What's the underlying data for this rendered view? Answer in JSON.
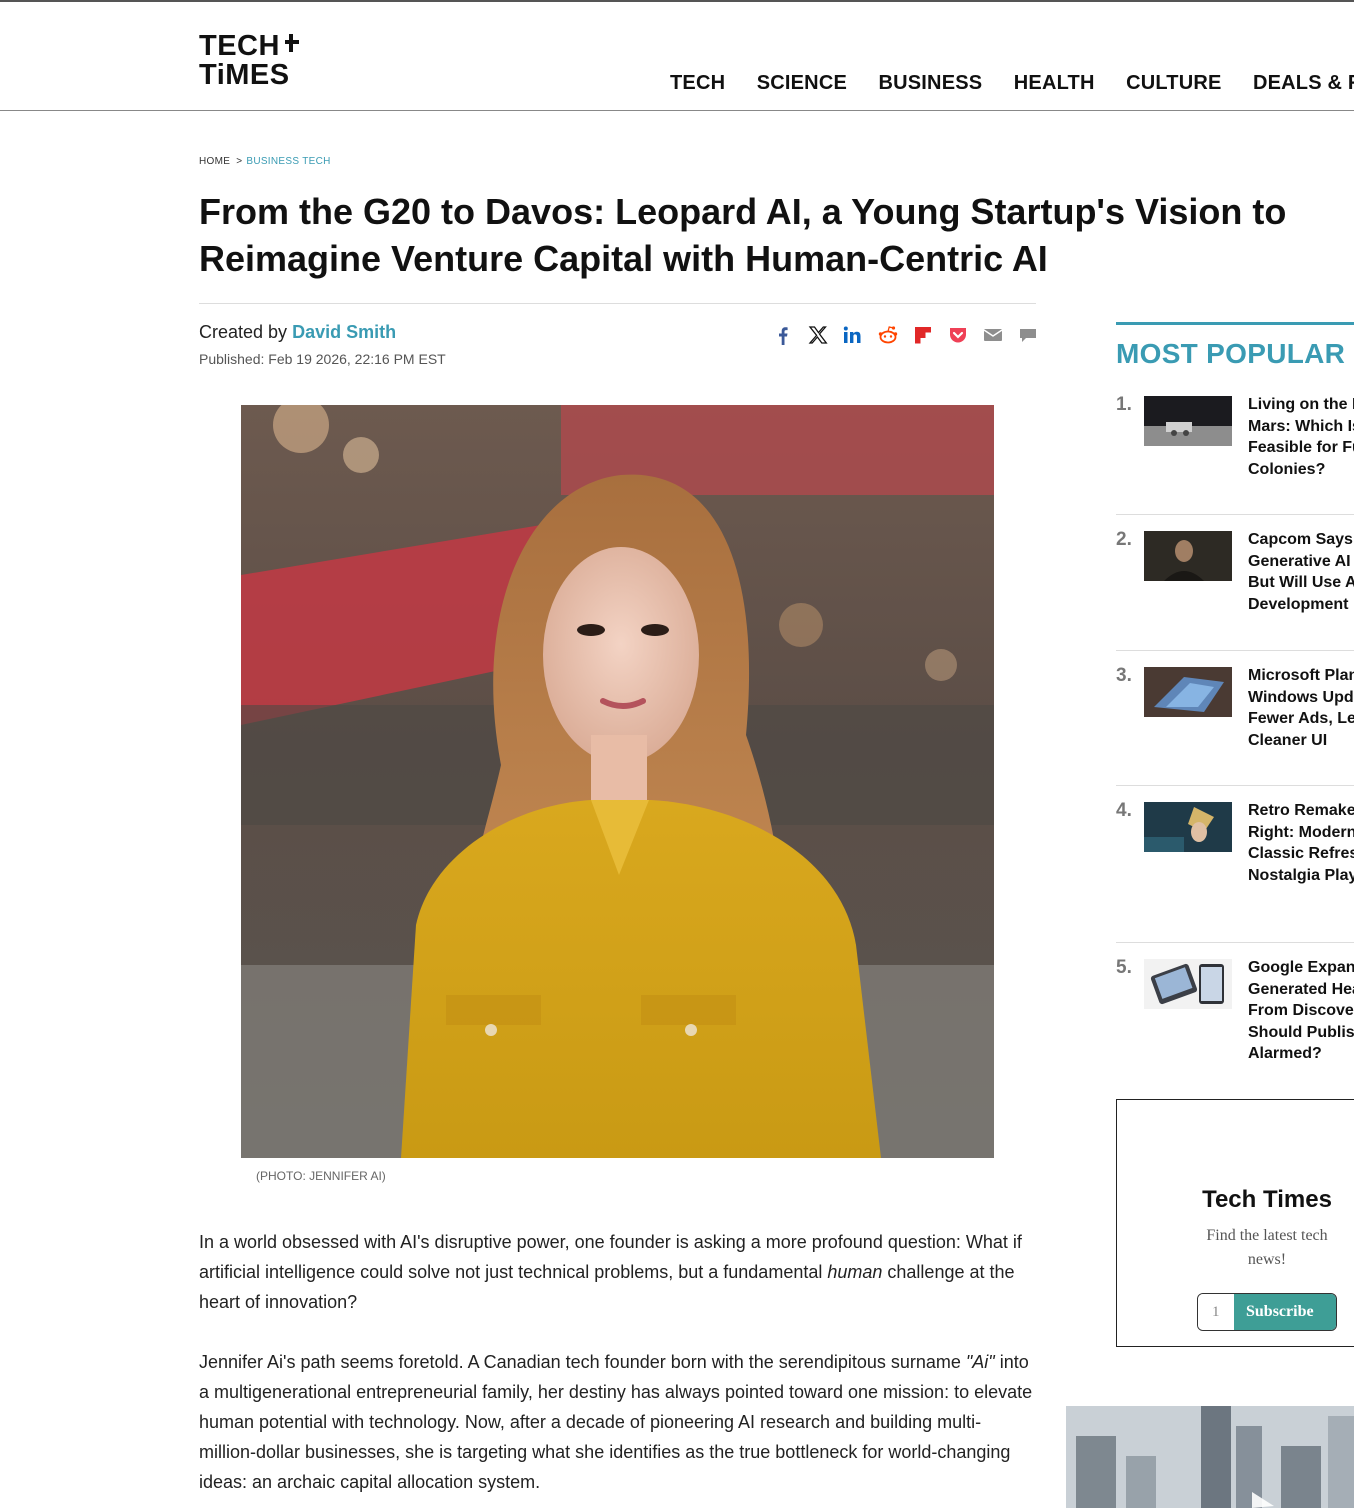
{
  "brand": {
    "line1": "TECH",
    "line2": "TiMES"
  },
  "nav": [
    "TECH",
    "SCIENCE",
    "BUSINESS",
    "HEALTH",
    "CULTURE",
    "DEALS & RE"
  ],
  "breadcrumb": {
    "home": "HOME",
    "separator": ">",
    "category": "BUSINESS TECH"
  },
  "article": {
    "title": "From the G20 to Davos: Leopard AI, a Young Startup's Vision to Reimagine Venture Capital with Human-Centric AI",
    "byline_prefix": "Created by",
    "author": "David Smith",
    "published": "Published: Feb 19 2026, 22:16 PM EST",
    "photo_caption": "(PHOTO: JENNIFER AI)",
    "p1_a": "In a world obsessed with AI's disruptive power, one founder is asking a more profound question: What if artificial intelligence could solve not just technical problems, but a fundamental ",
    "p1_em": "human",
    "p1_b": " challenge at the heart of innovation?",
    "p2_a": "Jennifer Ai's path seems foretold. A Canadian tech founder born with the serendipitous surname ",
    "p2_em": "\"Ai\"",
    "p2_b": " into a multigenerational entrepreneurial family, her destiny has always pointed toward one mission: to elevate human potential with technology. Now, after a decade of pioneering AI research and building multi-million-dollar businesses, she is targeting what she identifies as the true bottleneck for world-changing ideas: an archaic capital allocation system."
  },
  "share_icons": [
    "facebook-icon",
    "x-icon",
    "linkedin-icon",
    "reddit-icon",
    "flipboard-icon",
    "pocket-icon",
    "email-icon",
    "comment-icon"
  ],
  "most_popular": {
    "title": "MOST POPULAR",
    "items": [
      {
        "num": "1.",
        "text": "Living on the Moon vs Mars: Which Is More Feasible for Future Space Colonies?"
      },
      {
        "num": "2.",
        "text": "Capcom Says No Generative AI in Games But Will Use AI in Game Development"
      },
      {
        "num": "3.",
        "text": "Microsoft Plans 'Calmer' Windows Update With Fewer Ads, Less Upsell, Cleaner UI"
      },
      {
        "num": "4.",
        "text": "Retro Remakes Done Right: Modern Gameplay, Classic Refresh, and the Nostalgia Players Crave"
      },
      {
        "num": "5.",
        "text": "Google Expands AI-Generated Headlines From Discover to Search: Should Publishers Be Alarmed?"
      }
    ]
  },
  "newsletter": {
    "title": "Tech Times",
    "subtitle": "Find the latest tech news!",
    "input_value": "1",
    "button": "Subscribe"
  },
  "colors": {
    "accent": "#3a9bb3",
    "subscribe": "#3e9e96"
  }
}
